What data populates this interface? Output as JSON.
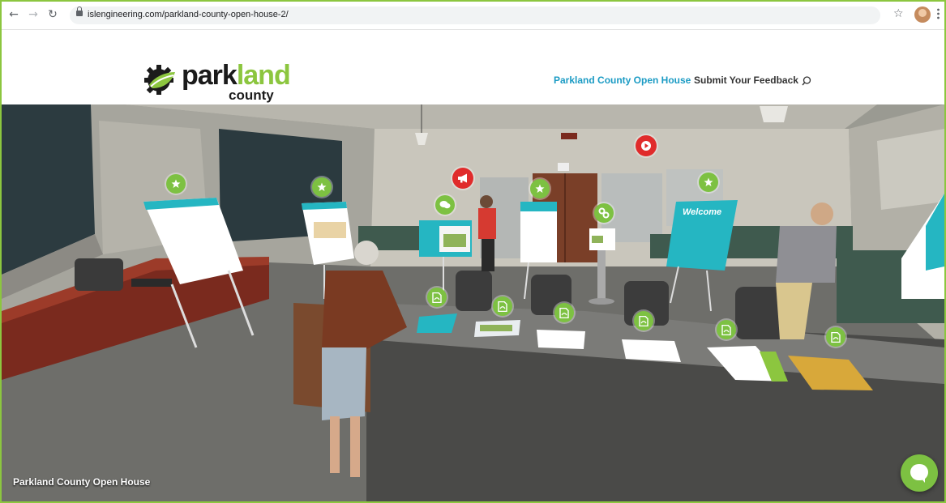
{
  "browser": {
    "url": "islengineering.com/parkland-county-open-house-2/",
    "back_icon": "back-arrow-icon",
    "forward_icon": "forward-arrow-icon",
    "reload_icon": "reload-icon",
    "bookmark_icon": "star-icon",
    "menu_icon": "kebab-menu-icon"
  },
  "site": {
    "logo_word_part1": "park",
    "logo_word_part2": "land",
    "logo_sub": "county",
    "nav": [
      {
        "label": "Parkland County Open House",
        "active": true
      },
      {
        "label": "Submit Your Feedback",
        "active": false
      }
    ],
    "search_icon": "search-icon",
    "accent_color": "#1b9bc4",
    "brand_green": "#8cc63f"
  },
  "scene": {
    "caption": "Parkland County Open House",
    "welcome_board_title": "Welcome",
    "hotspots": [
      {
        "name": "star-hotspot-1",
        "type": "star"
      },
      {
        "name": "star-hotspot-2",
        "type": "star"
      },
      {
        "name": "chat-hotspot",
        "type": "chat"
      },
      {
        "name": "announcement-hotspot",
        "type": "megaphone"
      },
      {
        "name": "star-hotspot-3",
        "type": "star"
      },
      {
        "name": "link-hotspot",
        "type": "link"
      },
      {
        "name": "video-hotspot",
        "type": "play"
      },
      {
        "name": "star-hotspot-4",
        "type": "star"
      },
      {
        "name": "pdf-hotspot-1",
        "type": "pdf"
      },
      {
        "name": "pdf-hotspot-2",
        "type": "pdf"
      },
      {
        "name": "pdf-hotspot-3",
        "type": "pdf"
      },
      {
        "name": "pdf-hotspot-4",
        "type": "pdf"
      },
      {
        "name": "pdf-hotspot-5",
        "type": "pdf"
      },
      {
        "name": "pdf-hotspot-6",
        "type": "pdf"
      }
    ],
    "chat_icon": "chat-bubble-icon"
  }
}
